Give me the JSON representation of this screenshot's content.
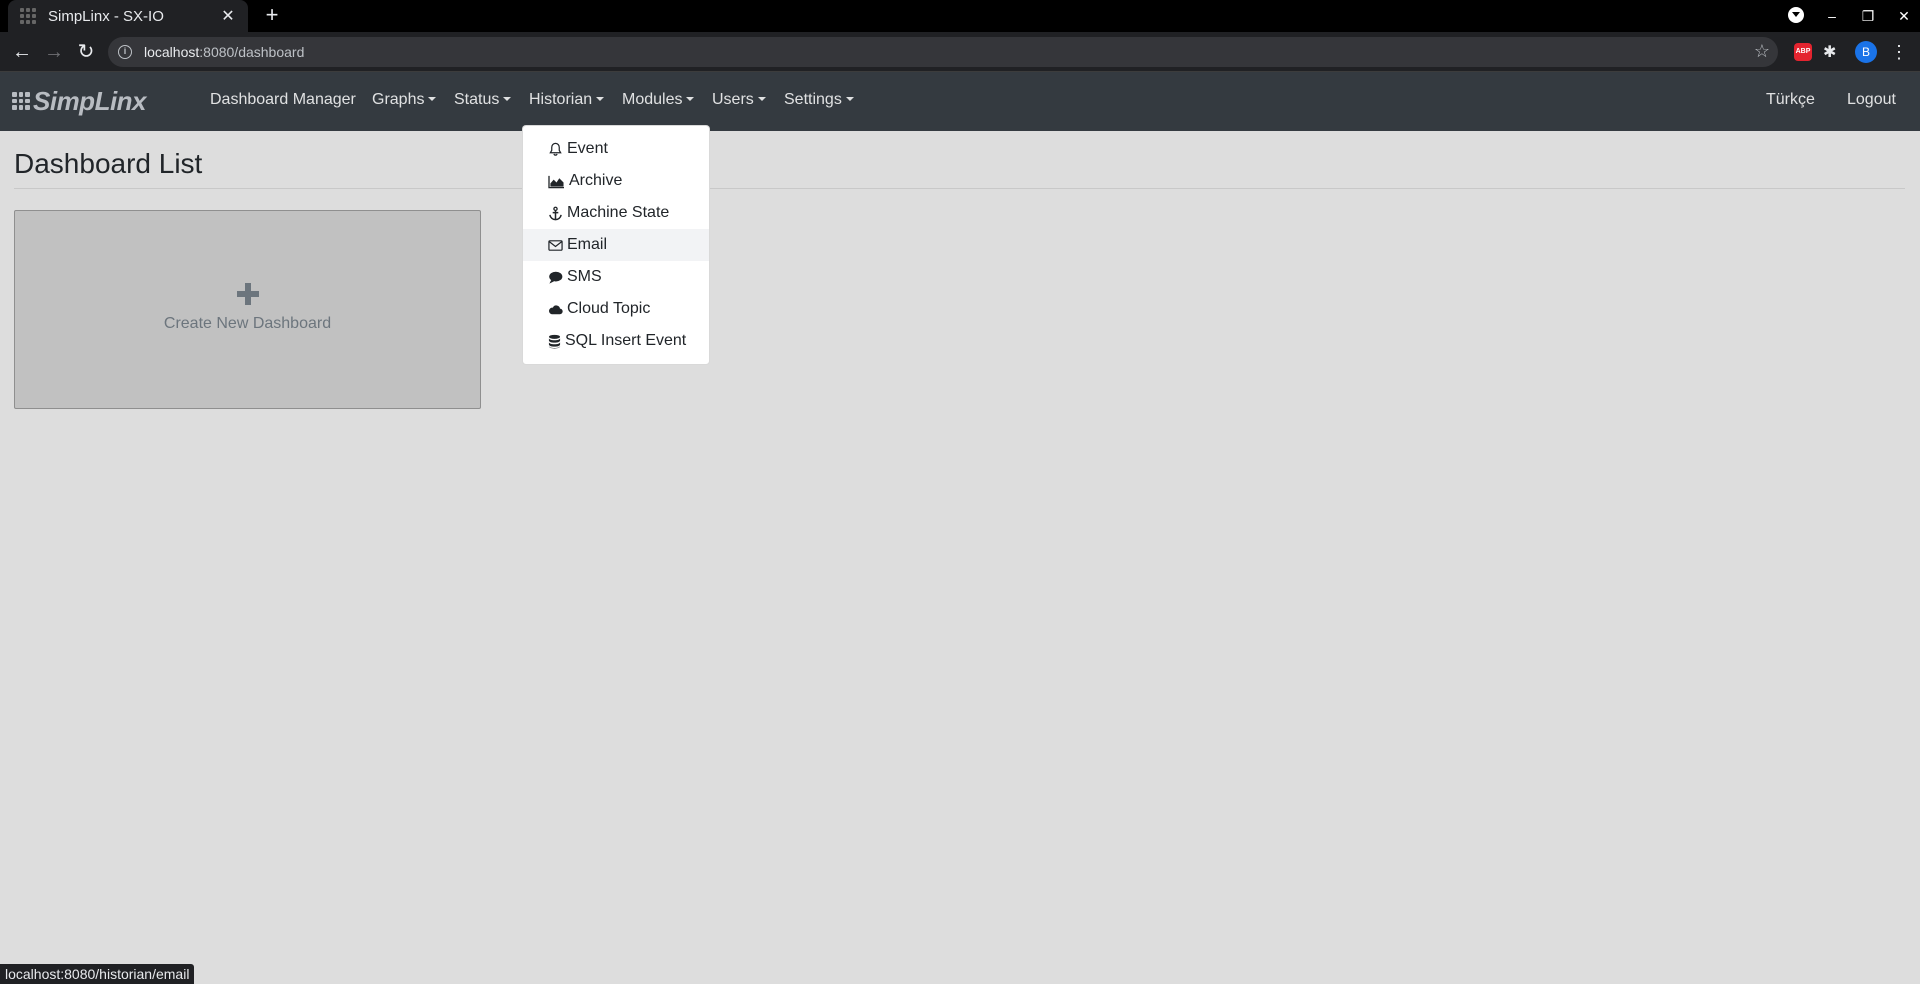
{
  "browser": {
    "tab_title": "SimpLinx - SX-IO",
    "tab_close": "✕",
    "new_tab": "+",
    "url_host": "localhost",
    "url_rest": ":8080/dashboard",
    "profile_initial": "B",
    "abp_label": "ABP",
    "window_controls": {
      "minimize": "–",
      "maximize": "❐",
      "close": "✕"
    }
  },
  "navbar": {
    "brand": "SimpLinx",
    "items": [
      {
        "label": "Dashboard Manager",
        "dropdown": false
      },
      {
        "label": "Graphs",
        "dropdown": true
      },
      {
        "label": "Status",
        "dropdown": true
      },
      {
        "label": "Historian",
        "dropdown": true
      },
      {
        "label": "Modules",
        "dropdown": true
      },
      {
        "label": "Users",
        "dropdown": true
      },
      {
        "label": "Settings",
        "dropdown": true
      }
    ],
    "language": "Türkçe",
    "logout": "Logout"
  },
  "historian_menu": {
    "items": [
      {
        "label": "Event",
        "icon": "bell-icon"
      },
      {
        "label": "Archive",
        "icon": "area-chart-icon"
      },
      {
        "label": "Machine State",
        "icon": "anchor-icon"
      },
      {
        "label": "Email",
        "icon": "envelope-icon",
        "hovered": true
      },
      {
        "label": "SMS",
        "icon": "comment-icon"
      },
      {
        "label": "Cloud Topic",
        "icon": "cloud-icon"
      },
      {
        "label": "SQL Insert Event",
        "icon": "database-icon"
      }
    ]
  },
  "main": {
    "title": "Dashboard List",
    "create_card_label": "Create New Dashboard"
  },
  "statusbar": {
    "url": "localhost:8080/historian/email"
  }
}
